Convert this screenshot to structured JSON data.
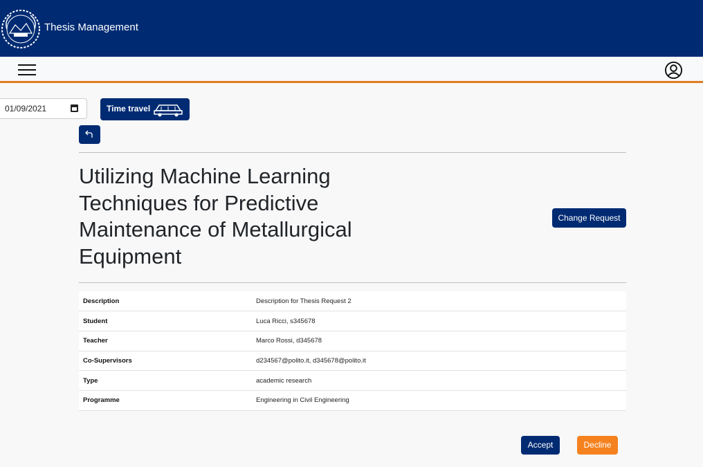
{
  "header": {
    "app_title": "Thesis Management"
  },
  "navbar": {
    "menu_icon": "hamburger-menu-icon",
    "user_icon": "user-circle-icon"
  },
  "toolbar": {
    "date_value": "01/09/2021",
    "time_travel_label": "Time travel",
    "time_travel_icon": "car-icon",
    "back_icon": "back-arrow-icon"
  },
  "thesis": {
    "title": "Utilizing Machine Learning Techniques for Predictive Maintenance of Metallurgical Equipment",
    "change_request_label": "Change Request",
    "details": [
      {
        "key": "Description",
        "value": "Description for Thesis Request 2"
      },
      {
        "key": "Student",
        "value": "Luca Ricci, s345678"
      },
      {
        "key": "Teacher",
        "value": "Marco Rossi, d345678"
      },
      {
        "key": "Co-Supervisors",
        "value": "d234567@polito.it, d345678@polito.it"
      },
      {
        "key": "Type",
        "value": "academic research"
      },
      {
        "key": "Programme",
        "value": "Engineering in Civil Engineering"
      }
    ]
  },
  "actions": {
    "accept_label": "Accept",
    "decline_label": "Decline"
  },
  "colors": {
    "primary": "#002b73",
    "accent": "#e07a1f",
    "decline": "#f5821f"
  }
}
